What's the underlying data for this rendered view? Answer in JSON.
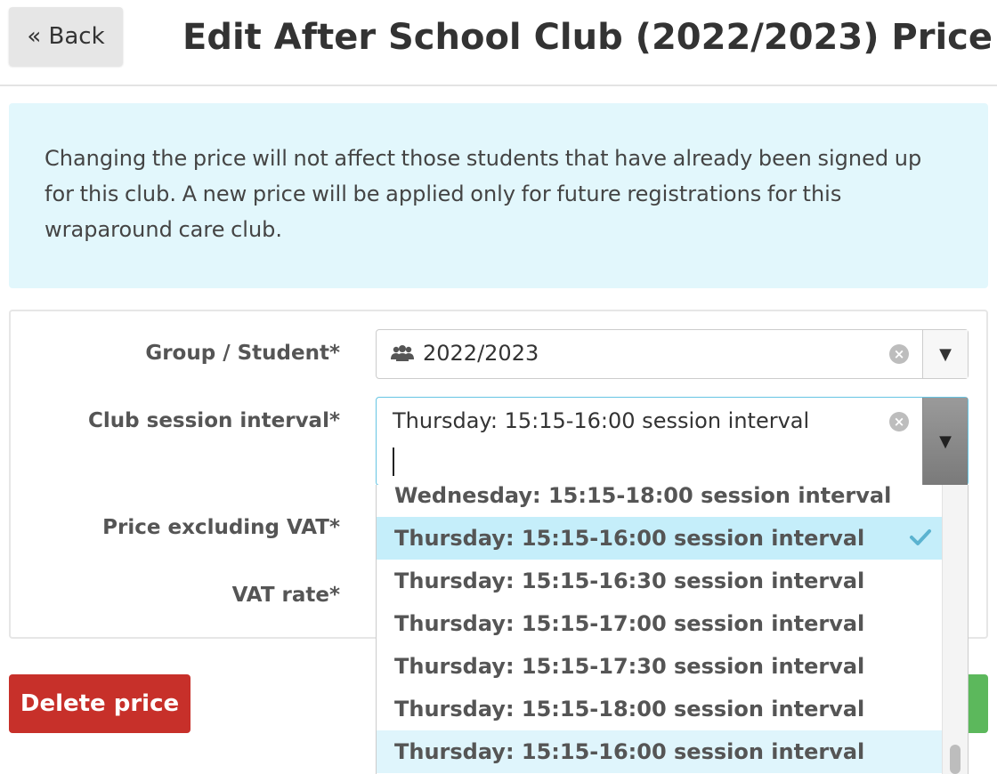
{
  "header": {
    "back_label": "« Back",
    "title": "Edit After School Club (2022/2023) Price"
  },
  "info": {
    "text": "Changing the price will not affect those students that have already been signed up for this club. A new price will be applied only for future registrations for this wraparound care club."
  },
  "form": {
    "group_label": "Group / Student*",
    "group_value": "2022/2023",
    "session_label": "Club session interval*",
    "session_value": "Thursday: 15:15-16:00 session interval",
    "price_label": "Price excluding VAT*",
    "vat_label": "VAT rate*"
  },
  "dropdown": {
    "options": [
      "Wednesday: 15:15-18:00 session interval",
      "Thursday: 15:15-16:00 session interval",
      "Thursday: 15:15-16:30 session interval",
      "Thursday: 15:15-17:00 session interval",
      "Thursday: 15:15-17:30 session interval",
      "Thursday: 15:15-18:00 session interval",
      "Thursday: 15:15-16:00 session interval"
    ],
    "selected_index": 1,
    "highlighted_index": 6
  },
  "actions": {
    "delete_label": "Delete price"
  },
  "colors": {
    "info_bg": "#e2f7fc",
    "delete_bg": "#c7302a",
    "selected_option_bg": "#c5eefa",
    "check": "#5bb3d0",
    "save_green": "#5cb85c"
  }
}
